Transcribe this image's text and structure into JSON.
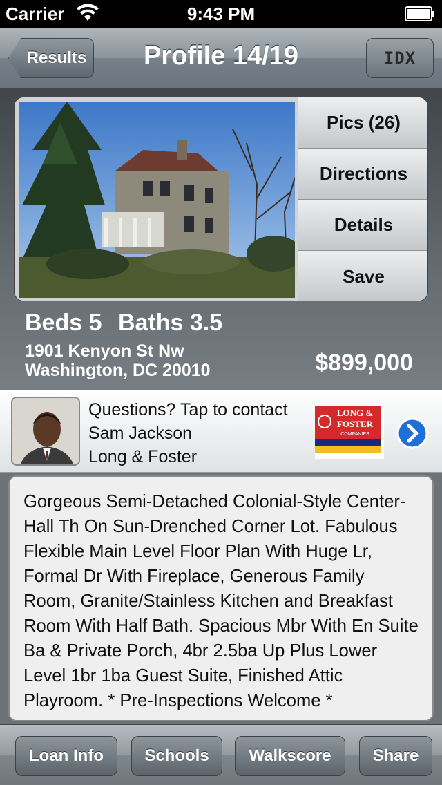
{
  "status_bar": {
    "carrier": "Carrier",
    "time": "9:43 PM"
  },
  "nav": {
    "back_label": "Results",
    "title": "Profile 14/19",
    "idx_logo_text": "IDX"
  },
  "listing": {
    "actions": [
      "Pics (26)",
      "Directions",
      "Details",
      "Save"
    ],
    "beds": "Beds 5",
    "baths": "Baths 3.5",
    "address_line1": "1901 Kenyon St Nw",
    "address_line2": "Washington, DC 20010",
    "price": "$899,000"
  },
  "agent": {
    "prompt": "Questions? Tap to contact",
    "name": "Sam Jackson",
    "company": "Long & Foster",
    "broker_logo_lines": [
      "LONG &",
      "FOSTER",
      "COMPANIES"
    ]
  },
  "description": "Gorgeous Semi-Detached Colonial-Style Center-Hall Th On Sun-Drenched Corner Lot. Fabulous Flexible Main Level Floor Plan With Huge Lr, Formal Dr With Fireplace, Generous Family Room, Granite/Stainless Kitchen and Breakfast Room With Half Bath. Spacious Mbr With En Suite Ba & Private Porch, 4br 2.5ba Up Plus Lower Level 1br 1ba Guest Suite, Finished Attic Playroom. * Pre-Inspections Welcome *",
  "toolbar": {
    "loan_label": "Loan Info",
    "schools_label": "Schools",
    "walkscore_label": "Walkscore",
    "share_label": "Share"
  },
  "colors": {
    "disclosure_blue": "#1f6fd8",
    "broker_red": "#d42a2a",
    "broker_navy": "#1a2a7a",
    "broker_gold": "#f0c020"
  }
}
